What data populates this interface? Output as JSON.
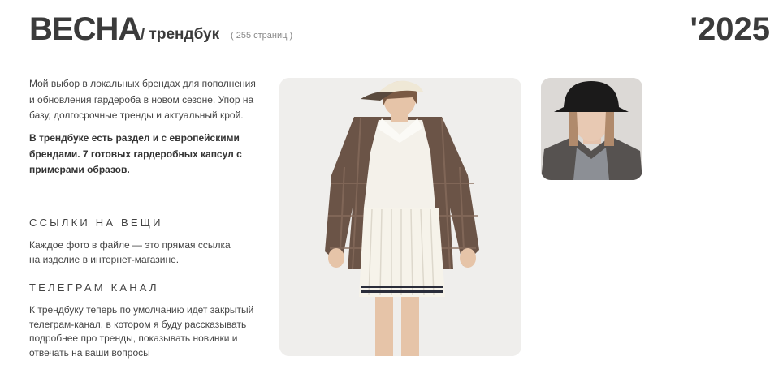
{
  "header": {
    "title": "ВЕСНА",
    "subtitle": "/ трендбук",
    "pages": "( 255 страниц )",
    "year": "'2025"
  },
  "intro": {
    "text": "Мой выбор в локальных брендах для пополнения и обновления гардероба в новом сезоне. Упор на базу, долгосрочные тренды и актуальный крой.",
    "bold": "В трендбуке есть раздел и с европейскими брендами. 7 готовых гардеробных капсул с примерами образов."
  },
  "sections": [
    {
      "heading": "ССЫЛКИ НА ВЕЩИ",
      "text": "Каждое фото в файле — это прямая ссылка на изделие в интернет-магазине."
    },
    {
      "heading": "ТЕЛЕГРАМ КАНАЛ",
      "text": "К трендбуку теперь по умолчанию идет закрытый телеграм-канал, в котором я буду рассказывать подробнее про тренды, показывать новинки и отвечать на ваши вопросы"
    }
  ]
}
